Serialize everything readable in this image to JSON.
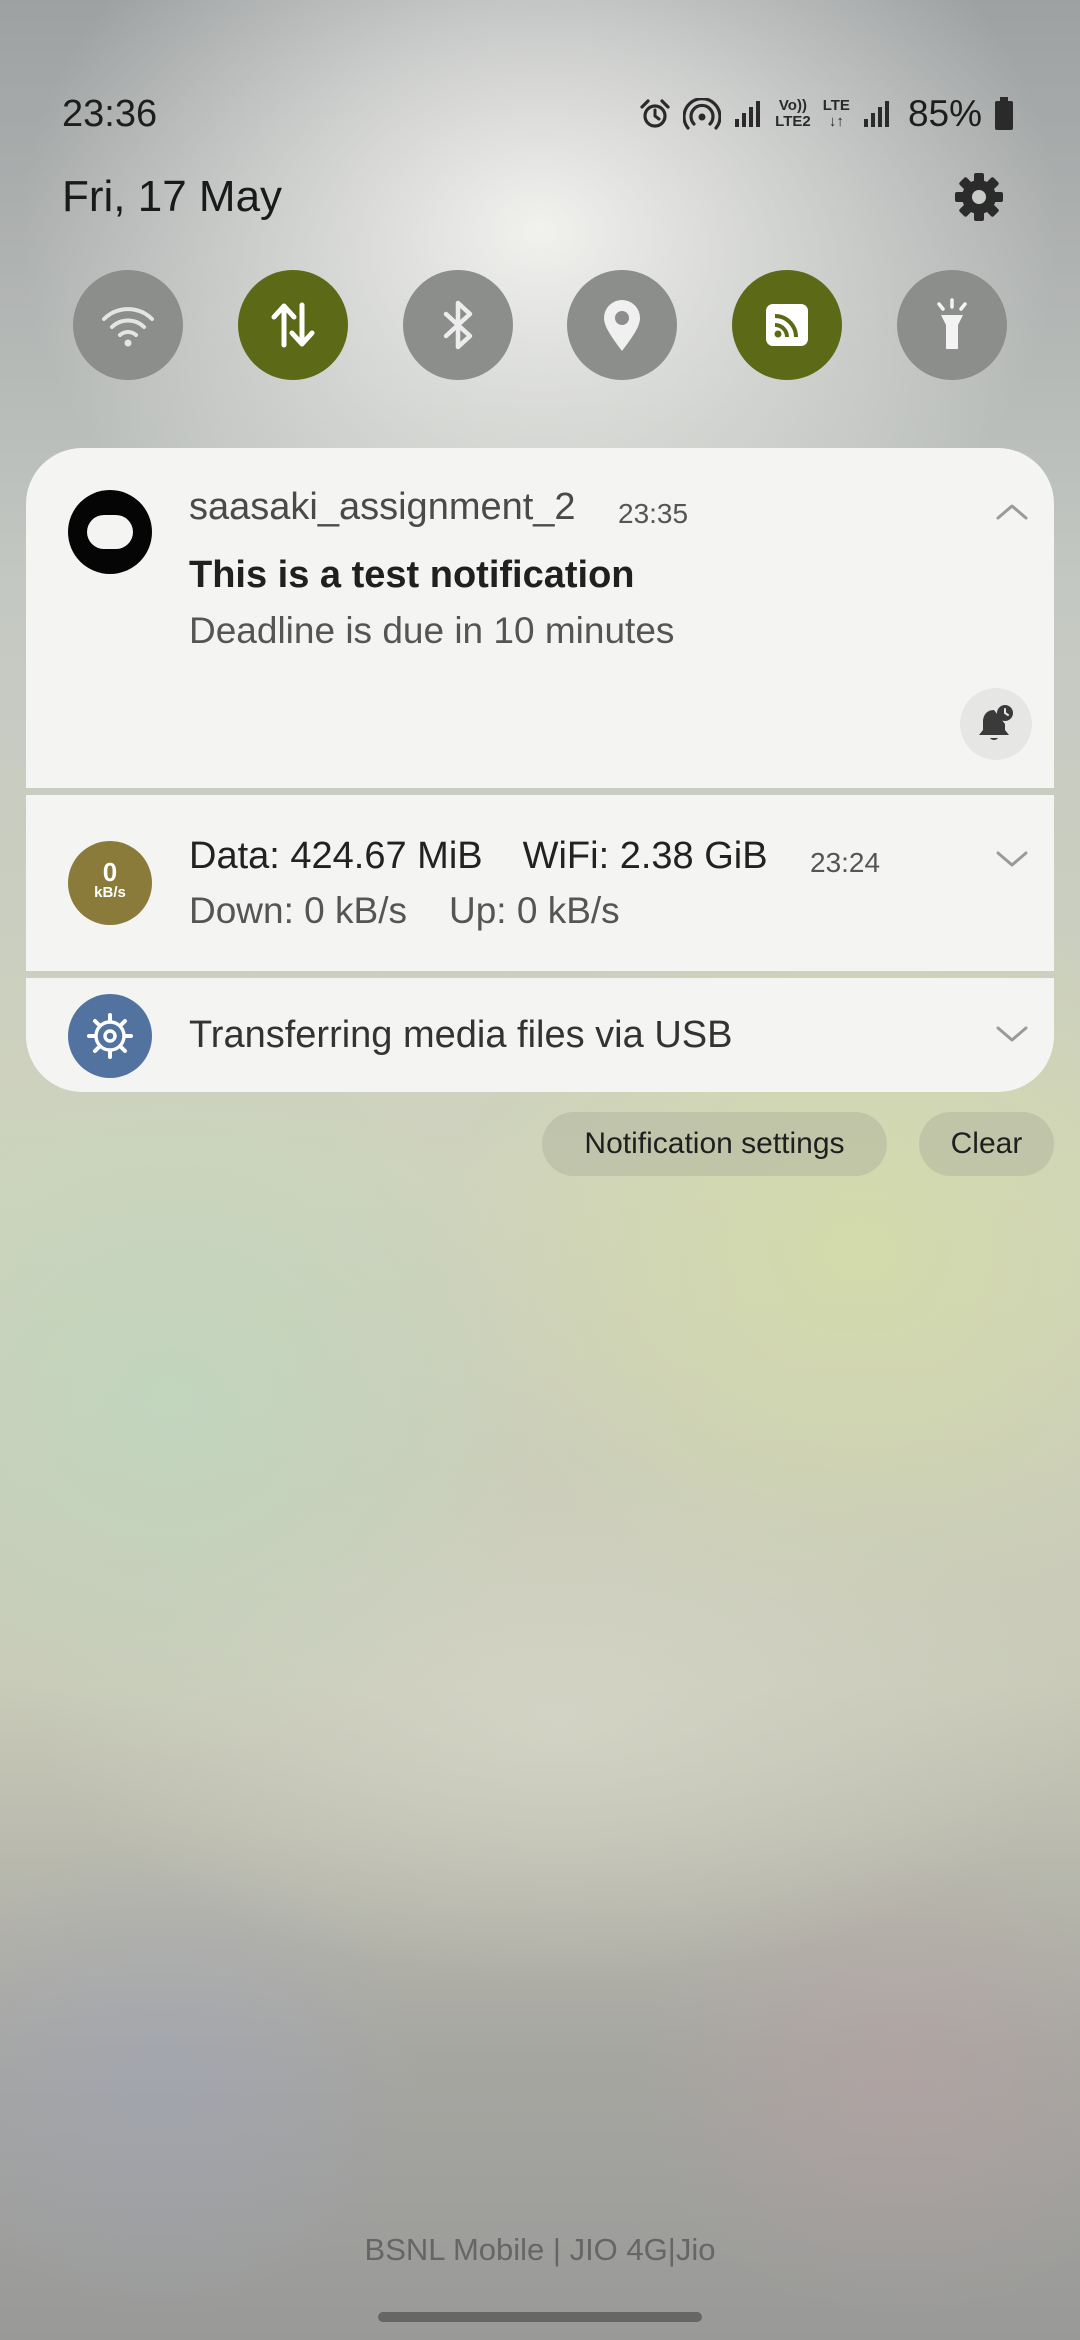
{
  "status_bar": {
    "time": "23:36",
    "battery_percent": "85%",
    "volte_top": "Vo))",
    "volte_bottom": "LTE2",
    "lte_label": "LTE",
    "icons": [
      "alarm-icon",
      "hotspot-icon",
      "signal-icon",
      "volte-icon",
      "lte-data-icon",
      "signal-icon",
      "battery-icon"
    ]
  },
  "header": {
    "date": "Fri, 17 May"
  },
  "quick_settings": [
    {
      "name": "wifi",
      "icon": "wifi-icon",
      "active": false
    },
    {
      "name": "mobile-data",
      "icon": "data-transfer-icon",
      "active": true
    },
    {
      "name": "bluetooth",
      "icon": "bluetooth-icon",
      "active": false
    },
    {
      "name": "location",
      "icon": "location-icon",
      "active": false
    },
    {
      "name": "nfc",
      "icon": "nfc-icon",
      "active": true
    },
    {
      "name": "flashlight",
      "icon": "flashlight-icon",
      "active": false
    }
  ],
  "notifications": {
    "app": {
      "name": "saasaki_assignment_2",
      "time": "23:35",
      "title": "This is a test notification",
      "body": "Deadline is due in 10 minutes"
    },
    "data_monitor": {
      "icon_value": "0",
      "icon_unit": "kB/s",
      "data": "Data: 424.67 MiB",
      "wifi": "WiFi: 2.38 GiB",
      "time": "23:24",
      "down": "Down: 0 kB/s",
      "up": "Up: 0 kB/s"
    },
    "usb": {
      "text": "Transferring media files via USB"
    }
  },
  "actions": {
    "settings_label": "Notification settings",
    "clear_label": "Clear"
  },
  "footer": {
    "carrier": "BSNL Mobile | JIO 4G|Jio"
  },
  "colors": {
    "active_tile": "#5c6a17",
    "inactive_tile": "#8b8e8b",
    "speed_icon": "#8a7b3a",
    "usb_icon": "#52739f"
  }
}
